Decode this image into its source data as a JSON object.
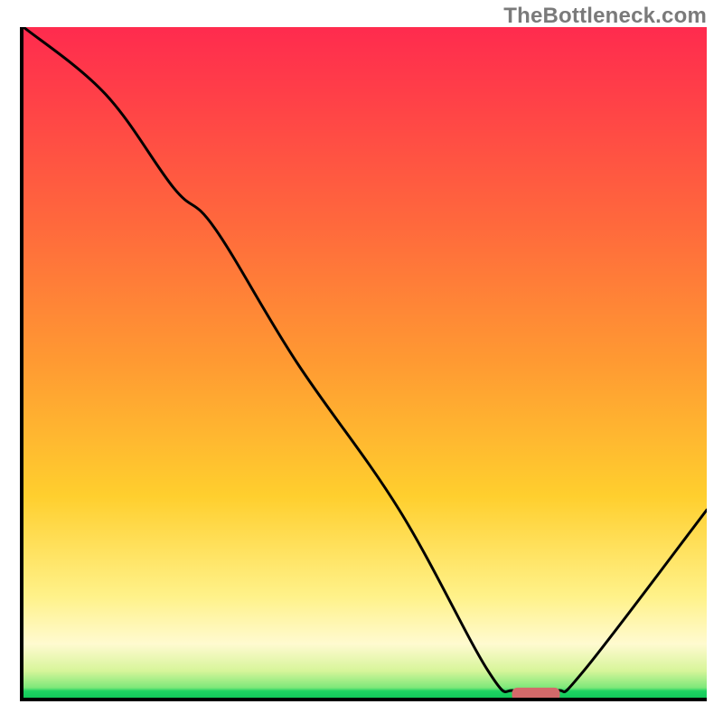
{
  "watermark": "TheBottleneck.com",
  "chart_data": {
    "type": "line",
    "title": "",
    "xlabel": "",
    "ylabel": "",
    "xlim": [
      0,
      100
    ],
    "ylim": [
      0,
      100
    ],
    "grid": false,
    "legend": false,
    "series": [
      {
        "name": "bottleneck-curve",
        "x": [
          0,
          12,
          22,
          28,
          40,
          55,
          68,
          72,
          78,
          82,
          100
        ],
        "y": [
          100,
          90,
          76,
          70,
          50,
          28,
          4,
          1,
          1,
          4,
          28
        ]
      }
    ],
    "annotations": [
      {
        "name": "optimal-marker",
        "shape": "rounded-rect",
        "x_center": 75,
        "y_center": 0.5,
        "width": 7,
        "height": 2,
        "color": "#d36a6a"
      }
    ],
    "background": {
      "type": "vertical-gradient",
      "stops": [
        {
          "pos": 0,
          "color": "#ff2b4e"
        },
        {
          "pos": 0.3,
          "color": "#ff6a3c"
        },
        {
          "pos": 0.5,
          "color": "#ff9a32"
        },
        {
          "pos": 0.7,
          "color": "#ffcf2e"
        },
        {
          "pos": 0.92,
          "color": "#fffad0"
        },
        {
          "pos": 0.98,
          "color": "#7ee87a"
        },
        {
          "pos": 1.0,
          "color": "#12c95a"
        }
      ]
    }
  }
}
